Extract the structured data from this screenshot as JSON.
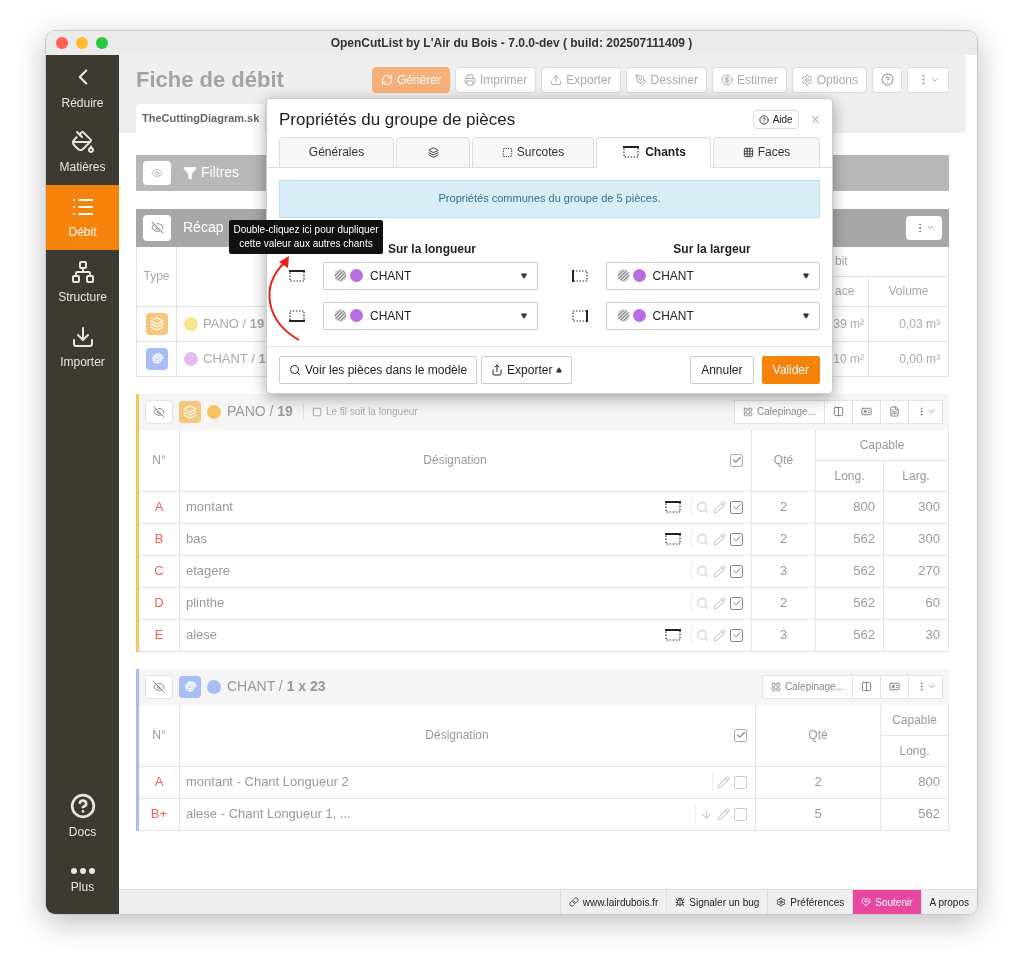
{
  "window": {
    "title": "OpenCutList by L'Air du Bois - 7.0.0-dev ( build: 202507111409 )"
  },
  "sidebar": {
    "items": [
      {
        "label": "Réduire",
        "kind": "back",
        "selected": false
      },
      {
        "label": "Matières",
        "kind": "materials",
        "selected": false
      },
      {
        "label": "Débit",
        "kind": "cutlist",
        "selected": true
      },
      {
        "label": "Structure",
        "kind": "structure",
        "selected": false
      },
      {
        "label": "Importer",
        "kind": "import",
        "selected": false
      }
    ],
    "bottom_items": [
      {
        "label": "Docs",
        "kind": "help"
      },
      {
        "label": "Plus",
        "kind": "more"
      }
    ]
  },
  "header": {
    "title": "Fiche de débit",
    "buttons": [
      {
        "label": "Générer",
        "kind": "generate"
      },
      {
        "label": "Imprimer",
        "kind": "print"
      },
      {
        "label": "Exporter",
        "kind": "export"
      },
      {
        "label": "Dessiner",
        "kind": "draw"
      },
      {
        "label": "Estimer",
        "kind": "estimate"
      },
      {
        "label": "Options",
        "kind": "options"
      },
      {
        "kind": "help"
      },
      {
        "kind": "menu"
      }
    ],
    "file_tab": "TheCuttingDiagram.sk"
  },
  "filters": {
    "label": "Filtres"
  },
  "summary": {
    "title": "Récap",
    "columns": [
      "Type",
      "bit",
      "ace",
      "Volume"
    ],
    "rows": [
      {
        "kind": "sheet",
        "color": "#f8e38a",
        "name": "PANO / **19**",
        "area": "39 m²",
        "volume": "0,03 m³"
      },
      {
        "kind": "edge",
        "color": "#e3bdf0",
        "name": "CHANT / **1**",
        "area": "10 m²",
        "volume": "0,00 m³"
      }
    ]
  },
  "groups": [
    {
      "kind": "sheet",
      "color": "#f5c45e",
      "name": "PANO / **19**",
      "note": "Le fil suit la longueur",
      "calepinage": "Calepinage...",
      "columns": {
        "number": "N°",
        "name": "Désignation",
        "qty": "Qté",
        "capable": "Capable",
        "long": "Long.",
        "larg": "Larg."
      },
      "header_checked": true,
      "rows": [
        {
          "id": "A",
          "name": "montant",
          "edges": true,
          "expandable": false,
          "checked": true,
          "qty": "2",
          "long": "800",
          "larg": "300"
        },
        {
          "id": "B",
          "name": "bas",
          "edges": true,
          "expandable": false,
          "checked": true,
          "qty": "2",
          "long": "562",
          "larg": "300"
        },
        {
          "id": "C",
          "name": "etagere",
          "edges": false,
          "expandable": false,
          "checked": true,
          "qty": "3",
          "long": "562",
          "larg": "270"
        },
        {
          "id": "D",
          "name": "plinthe",
          "edges": false,
          "expandable": false,
          "checked": true,
          "qty": "2",
          "long": "562",
          "larg": "60"
        },
        {
          "id": "E",
          "name": "alese",
          "edges": true,
          "expandable": false,
          "checked": true,
          "qty": "3",
          "long": "562",
          "larg": "30"
        }
      ]
    },
    {
      "kind": "edge",
      "color": "#a9bdf5",
      "name": "CHANT / **1 x 23**",
      "calepinage": "Calepinage...",
      "columns": {
        "number": "N°",
        "name": "Désignation",
        "qty": "Qté",
        "capable": "Capable",
        "long": "Long."
      },
      "header_checked": true,
      "rows": [
        {
          "id": "A",
          "name": "montant - Chant Longueur 2",
          "edges": false,
          "expandable": false,
          "checked": false,
          "qty": "2",
          "long": "800"
        },
        {
          "id": "B+",
          "name": "alese - Chant Longueur 1, ...",
          "edges": false,
          "expandable": true,
          "checked": false,
          "qty": "5",
          "long": "562"
        }
      ]
    }
  ],
  "status_bar": [
    {
      "label": "www.lairdubois.fr",
      "kind": "link"
    },
    {
      "label": "Signaler un bug",
      "kind": "bug"
    },
    {
      "label": "Préférences",
      "kind": "prefs"
    },
    {
      "label": "Soutenir",
      "kind": "support"
    },
    {
      "label": "A propos",
      "kind": "about"
    }
  ],
  "dialog": {
    "title": "Propriétés du groupe de pièces",
    "help": "Aide",
    "close": "×",
    "tabs": [
      {
        "label": "Générales",
        "kind": "general",
        "selected": false
      },
      {
        "kind": "material",
        "selected": false
      },
      {
        "label": "Surcotes",
        "kind": "oversize",
        "selected": false
      },
      {
        "label": "Chants",
        "kind": "edges",
        "selected": true
      },
      {
        "label": "Faces",
        "kind": "faces",
        "selected": false
      }
    ],
    "info": "Propriétés communes du groupe de 5 pièces.",
    "headings": [
      "Sur la longueur",
      "Sur la largeur"
    ],
    "edges": [
      {
        "kind": "top",
        "value": "CHANT",
        "color": "#b86ee0"
      },
      {
        "kind": "left",
        "value": "CHANT",
        "color": "#b86ee0"
      },
      {
        "kind": "bottom",
        "value": "CHANT",
        "color": "#b86ee0"
      },
      {
        "kind": "right",
        "value": "CHANT",
        "color": "#b86ee0"
      }
    ],
    "buttons": [
      {
        "label": "Voir les pièces dans le modèle",
        "kind": "view"
      },
      {
        "label": "Exporter",
        "kind": "export"
      },
      {
        "label": "Annuler",
        "kind": "cancel"
      },
      {
        "label": "Valider",
        "kind": "ok"
      }
    ]
  },
  "tooltip": "Double-cliquez ici pour dupliquer cette valeur aux autres chants"
}
